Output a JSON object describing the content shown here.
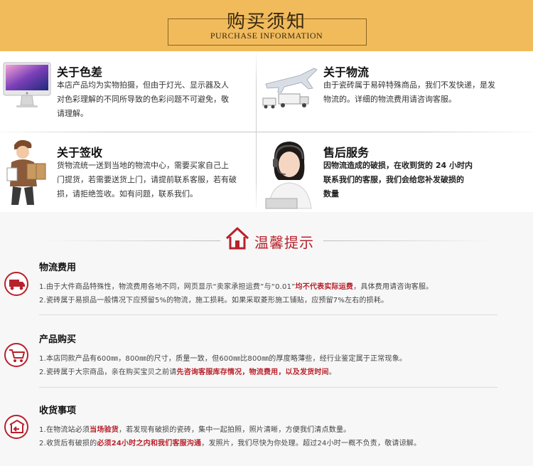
{
  "header": {
    "title": "购买须知",
    "subtitle": "PURCHASE INFORMATION"
  },
  "info": [
    {
      "title": "关于色差",
      "lines": [
        "本店产品均为实物拍摄，但由于灯光、显示器及人",
        "对色彩理解的不同所导致的色彩问题不可避免，敬",
        "请理解。"
      ],
      "icon": "imac-computer-icon"
    },
    {
      "title": "关于物流",
      "lines": [
        "由于瓷砖属于易碎特殊商品，我们不发快递，是发",
        "物流的。详细的物流费用请咨询客服。"
      ],
      "icon": "airplane-trucks-icon"
    },
    {
      "title": "关于签收",
      "lines": [
        "货物流统一送到当地的物流中心，需要买家自己上",
        "门提货，若需要送货上门，请提前联系客服，若有破",
        "损，请拒绝签收。如有问题，联系我们。"
      ],
      "icon": "delivery-man-icon"
    },
    {
      "title": "售后服务",
      "lines": [
        "因物流造成的破损，在收到货的 24 小时内",
        "联系我们的客服，我们会给您补发破损的",
        "数量"
      ],
      "icon": "customer-service-icon"
    }
  ],
  "tips": {
    "title": "温馨提示",
    "sections": [
      {
        "heading": "物流费用",
        "icon": "truck-icon",
        "line1_pre": "1.由于大件商品特殊性，物流费用各地不同，网页显示“卖家承担运费”与“0.01”",
        "line1_red": "均不代表实际运费",
        "line1_post": "，具体费用请咨询客服。",
        "line2": "2.瓷砖属于易损品一般情况下应预留5%的物流，施工损耗。如果采取菱形施工铺贴，应预留7%左右的损耗。"
      },
      {
        "heading": "产品购买",
        "icon": "shopping-cart-icon",
        "line1": "1.本店同款产品有600㎜，800㎜的尺寸，质量一致，但600㎜比800㎜的厚度略薄些，经行业鉴定属于正常现象。",
        "line2_pre": "2.瓷砖属于大宗商品，亲在购买宝贝之前请",
        "line2_red": "先咨询客服库存情况，物流费用，以及发货时间",
        "line2_post": "。"
      },
      {
        "heading": "收货事项",
        "icon": "return-box-icon",
        "line1_pre": "1.在物流站必须",
        "line1_red": "当场验货",
        "line1_post": "，若发现有破损的瓷砖，集中一起拍照，照片清晰，方便我们清点数量。",
        "line2_pre": "2.收货后有破损的",
        "line2_red": "必须24小时之内和我们客服沟通",
        "line2_post": "，发照片，我们尽快为你处理。超过24小时一概不负责，敬请谅解。"
      }
    ]
  },
  "colors": {
    "banner": "#f1bb5c",
    "accent_red": "#b8212b"
  }
}
